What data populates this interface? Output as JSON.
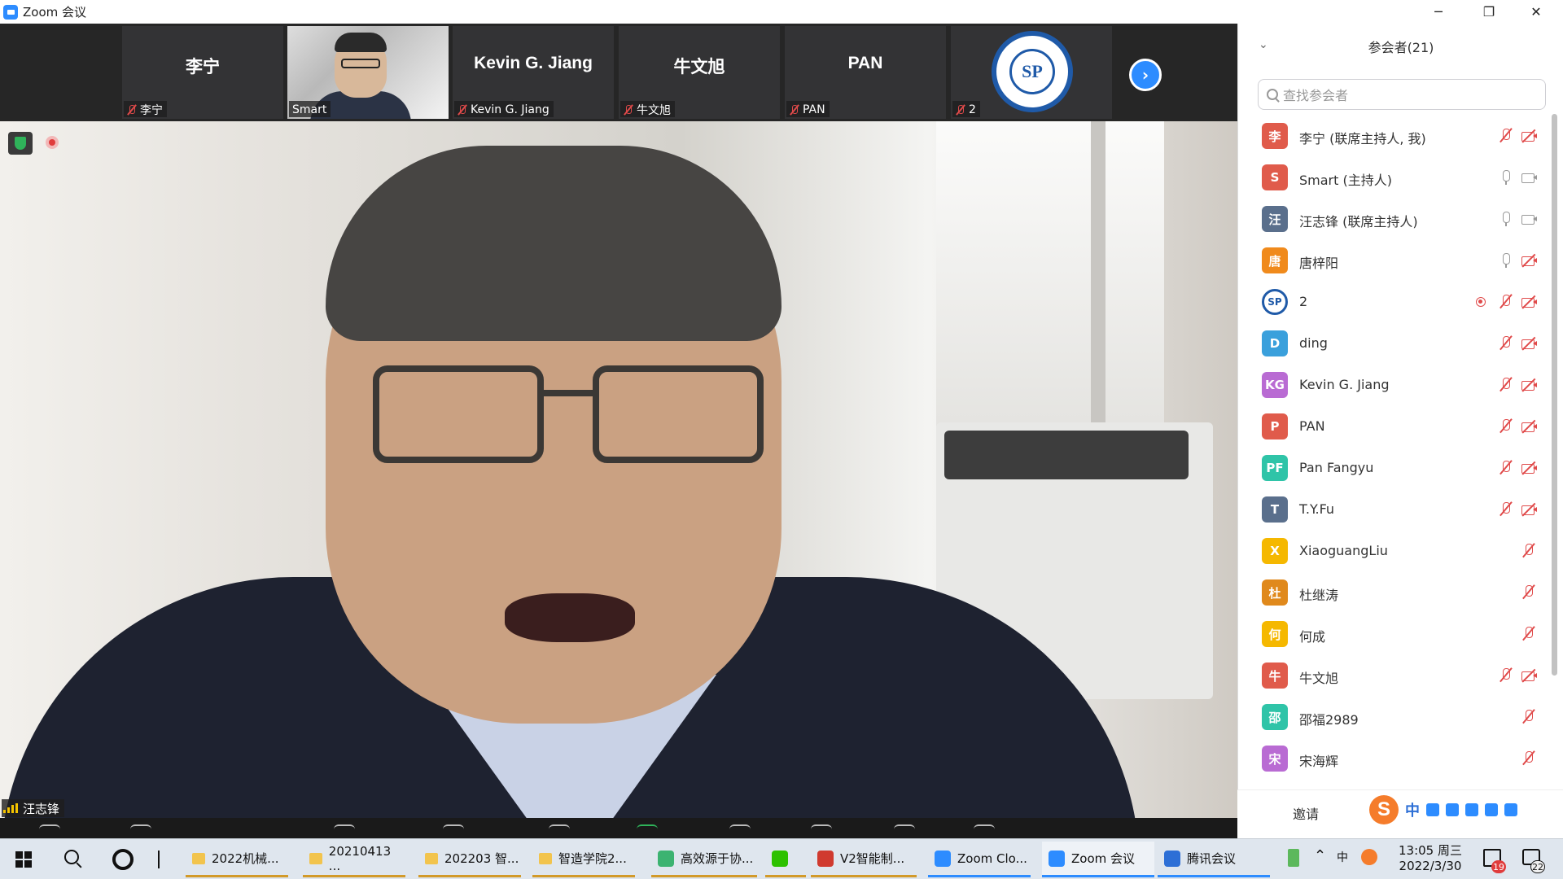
{
  "window": {
    "title": "Zoom 会议"
  },
  "gallery": {
    "tiles": [
      {
        "big_name": "李宁",
        "label": "李宁"
      },
      {
        "big_name": "",
        "label": "Smart"
      },
      {
        "big_name": "Kevin G. Jiang",
        "label": "Kevin G. Jiang"
      },
      {
        "big_name": "牛文旭",
        "label": "牛文旭"
      },
      {
        "big_name": "PAN",
        "label": "PAN"
      },
      {
        "big_name": "",
        "label": "2"
      }
    ],
    "logo_text": "SP"
  },
  "main": {
    "speaker_label": "汪志锋"
  },
  "participants": {
    "header": "参会者(21)",
    "search_placeholder": "查找参会者",
    "invite_label": "邀请",
    "list": [
      {
        "avatar": "李",
        "color": "#e05b4b",
        "name": "李宁 (联席主持人, 我)",
        "mic": "muted",
        "cam": "off"
      },
      {
        "avatar": "S",
        "color": "#e05b4b",
        "name": "Smart (主持人)",
        "mic": "on",
        "cam": "on"
      },
      {
        "avatar": "汪",
        "color": "#5a6f8c",
        "name": "汪志锋 (联席主持人)",
        "mic": "on",
        "cam": "on"
      },
      {
        "avatar": "唐",
        "color": "#f08a1c",
        "name": "唐梓阳",
        "mic": "on",
        "cam": "off"
      },
      {
        "avatar": "SP",
        "color": "logo",
        "name": "2",
        "mic": "muted",
        "cam": "off",
        "recording": true
      },
      {
        "avatar": "D",
        "color": "#3aa0dc",
        "name": "ding",
        "mic": "muted",
        "cam": "off"
      },
      {
        "avatar": "KG",
        "color": "#b96bd3",
        "name": "Kevin G. Jiang",
        "mic": "muted",
        "cam": "off"
      },
      {
        "avatar": "P",
        "color": "#e05b4b",
        "name": "PAN",
        "mic": "muted",
        "cam": "off"
      },
      {
        "avatar": "PF",
        "color": "#2fc4a8",
        "name": "Pan Fangyu",
        "mic": "muted",
        "cam": "off"
      },
      {
        "avatar": "T",
        "color": "#5a6f8c",
        "name": "T.Y.Fu",
        "mic": "muted",
        "cam": "off"
      },
      {
        "avatar": "X",
        "color": "#f5b800",
        "name": "XiaoguangLiu",
        "mic": "muted",
        "cam": "none"
      },
      {
        "avatar": "杜",
        "color": "#e0891c",
        "name": "杜继涛",
        "mic": "muted",
        "cam": "none"
      },
      {
        "avatar": "何",
        "color": "#f5b800",
        "name": "何成",
        "mic": "muted",
        "cam": "none"
      },
      {
        "avatar": "牛",
        "color": "#e05b4b",
        "name": "牛文旭",
        "mic": "muted",
        "cam": "off"
      },
      {
        "avatar": "邵",
        "color": "#2fc4a8",
        "name": "邵福2989",
        "mic": "muted",
        "cam": "none"
      },
      {
        "avatar": "宋",
        "color": "#b96bd3",
        "name": "宋海辉",
        "mic": "muted",
        "cam": "none"
      }
    ]
  },
  "ime": {
    "lang": "中"
  },
  "taskbar": {
    "items": [
      {
        "label": "2022机械...",
        "icon": "folder-icon"
      },
      {
        "label": "20210413 ...",
        "icon": "folder-icon"
      },
      {
        "label": "202203 智...",
        "icon": "folder-icon"
      },
      {
        "label": "智造学院2...",
        "icon": "folder-icon"
      },
      {
        "label": "高效源于协...",
        "icon": "browser-icon"
      },
      {
        "label": "",
        "icon": "wechat-icon"
      },
      {
        "label": "V2智能制...",
        "icon": "wps-icon"
      },
      {
        "label": "Zoom Clo...",
        "icon": "zoom-icon"
      },
      {
        "label": "Zoom 会议",
        "icon": "zoom-icon"
      },
      {
        "label": "腾讯会议",
        "icon": "tencent-meeting-icon"
      }
    ],
    "tray_lang": "中",
    "time": "13:05 周三",
    "date": "2022/3/30",
    "badge_left": "19",
    "badge_right": "22"
  }
}
